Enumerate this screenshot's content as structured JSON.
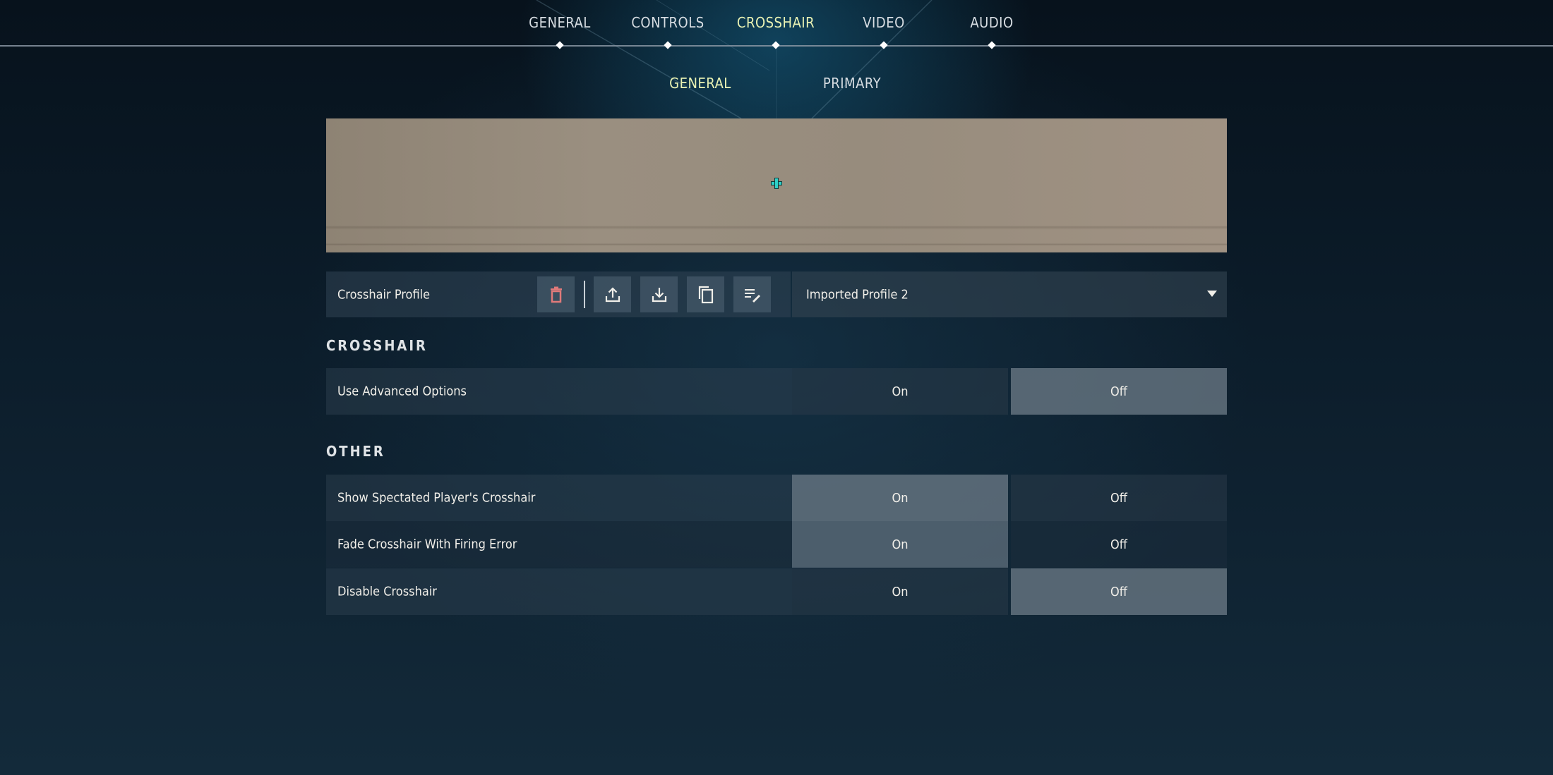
{
  "top_nav": {
    "tabs": [
      {
        "label": "GENERAL",
        "active": false
      },
      {
        "label": "CONTROLS",
        "active": false
      },
      {
        "label": "CROSSHAIR",
        "active": true
      },
      {
        "label": "VIDEO",
        "active": false
      },
      {
        "label": "AUDIO",
        "active": false
      }
    ]
  },
  "sub_nav": {
    "tabs": [
      {
        "label": "GENERAL",
        "active": true
      },
      {
        "label": "PRIMARY",
        "active": false
      }
    ]
  },
  "preview": {
    "crosshair_color": "#2fd0c8"
  },
  "profile": {
    "label": "Crosshair Profile",
    "actions": [
      {
        "icon": "trash-icon",
        "name": "delete-profile-button",
        "color": "#e07a7a"
      },
      {
        "icon": "upload-icon",
        "name": "export-profile-button"
      },
      {
        "icon": "download-icon",
        "name": "import-profile-button"
      },
      {
        "icon": "copy-icon",
        "name": "duplicate-profile-button"
      },
      {
        "icon": "rename-icon",
        "name": "rename-profile-button"
      }
    ],
    "selected": "Imported Profile 2"
  },
  "sections": {
    "crosshair": {
      "title": "CROSSHAIR",
      "settings": [
        {
          "label": "Use Advanced Options",
          "on_label": "On",
          "off_label": "Off",
          "value": "Off"
        }
      ]
    },
    "other": {
      "title": "OTHER",
      "settings": [
        {
          "label": "Show Spectated Player's Crosshair",
          "on_label": "On",
          "off_label": "Off",
          "value": "On"
        },
        {
          "label": "Fade Crosshair With Firing Error",
          "on_label": "On",
          "off_label": "Off",
          "value": "On"
        },
        {
          "label": "Disable Crosshair",
          "on_label": "On",
          "off_label": "Off",
          "value": "Off"
        }
      ]
    }
  },
  "colors": {
    "active_tab": "#eaf3b4",
    "text": "#ece8e1"
  }
}
